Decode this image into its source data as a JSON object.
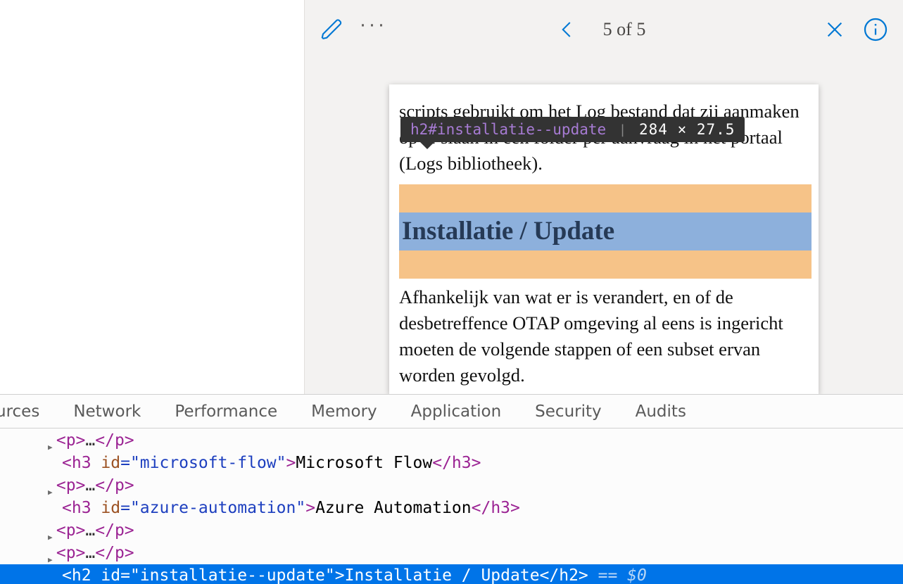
{
  "toolbar": {
    "page_counter": "5 of 5"
  },
  "tooltip": {
    "selector": "h2#installatie--update",
    "dimensions": "284 × 27.5"
  },
  "document": {
    "para_top": "scripts gebruikt om het Log bestand dat zij aanmaken op te slaan in een folder per aanvraag in het portaal (Logs bibliotheek).",
    "heading": "Installatie / Update",
    "para_bottom": "Afhankelijk van wat er is verandert, en of de desbetreffence OTAP omgeving al eens is ingericht moeten de volgende stappen of een subset ervan worden gevolgd."
  },
  "devtools": {
    "tabs": [
      "urces",
      "Network",
      "Performance",
      "Memory",
      "Application",
      "Security",
      "Audits"
    ],
    "dom": {
      "l1": {
        "open": "<p>",
        "mid": "…",
        "close": "</p>"
      },
      "l2": {
        "open_a": "<h3 ",
        "attr_n": "id",
        "attr_v": "=\"microsoft-flow\"",
        "open_b": ">",
        "text": "Microsoft Flow",
        "close": "</h3>"
      },
      "l3": {
        "open": "<p>",
        "mid": "…",
        "close": "</p>"
      },
      "l4": {
        "open_a": "<h3 ",
        "attr_n": "id",
        "attr_v": "=\"azure-automation\"",
        "open_b": ">",
        "text": "Azure Automation",
        "close": "</h3>"
      },
      "l5": {
        "open": "<p>",
        "mid": "…",
        "close": "</p>"
      },
      "l6": {
        "open": "<p>",
        "mid": "…",
        "close": "</p>"
      },
      "sel": {
        "open_a": "<h2 ",
        "attr_n": "id",
        "attr_v": "=\"installatie--update\"",
        "open_b": ">",
        "text": "Installatie / Update",
        "close": "</h2>",
        "suffix": " == $0"
      }
    }
  },
  "colors": {
    "accent": "#0078d4"
  }
}
